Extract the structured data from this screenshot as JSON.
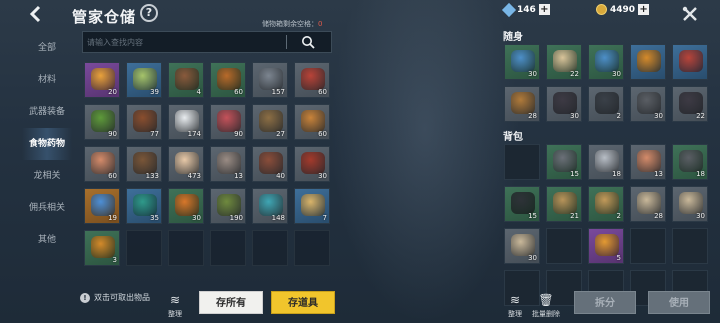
{
  "header": {
    "back_icon": "chevron-left-icon",
    "title": "管家仓储",
    "help_icon": "question-icon"
  },
  "capacity": {
    "label": "储物箱剩余空格：",
    "value": "0"
  },
  "search": {
    "placeholder": "请输入查找内容",
    "icon": "search-icon"
  },
  "sidebar": {
    "items": [
      {
        "label": "全部"
      },
      {
        "label": "材料"
      },
      {
        "label": "武器装备"
      },
      {
        "label": "食物药物",
        "active": true
      },
      {
        "label": "龙相关"
      },
      {
        "label": "佣兵相关"
      },
      {
        "label": "其他"
      }
    ]
  },
  "currency": {
    "gems": "146",
    "gold": "4490"
  },
  "warehouse": {
    "items": [
      {
        "q": "purple",
        "count": "20",
        "icon": "orange-drink-icon",
        "color": "#e9a23b"
      },
      {
        "q": "blue",
        "count": "39",
        "icon": "soup-bowl-icon",
        "color": "#a6c46a"
      },
      {
        "q": "green",
        "count": "4",
        "icon": "meat-platter-icon",
        "color": "#8a5a3c"
      },
      {
        "q": "green",
        "count": "60",
        "icon": "barrel-icon",
        "color": "#b86a2a"
      },
      {
        "q": "grey",
        "count": "157",
        "icon": "herb-icon",
        "color": "#7c8590"
      },
      {
        "q": "grey",
        "count": "60",
        "icon": "berries-icon",
        "color": "#b84338"
      },
      {
        "q": "grey",
        "count": "90",
        "icon": "leaf-food-icon",
        "color": "#5e9a3a"
      },
      {
        "q": "grey",
        "count": "77",
        "icon": "roast-meat-icon",
        "color": "#8a4e2e"
      },
      {
        "q": "grey",
        "count": "174",
        "icon": "rice-ball-icon",
        "color": "#e8ecef"
      },
      {
        "q": "grey",
        "count": "90",
        "icon": "raw-meat-icon",
        "color": "#c4525a"
      },
      {
        "q": "grey",
        "count": "27",
        "icon": "branch-icon",
        "color": "#8c6e44"
      },
      {
        "q": "grey",
        "count": "60",
        "icon": "stew-bowl-icon",
        "color": "#c8833a"
      },
      {
        "q": "grey",
        "count": "60",
        "icon": "shrimp-icon",
        "color": "#d48b6a"
      },
      {
        "q": "grey",
        "count": "133",
        "icon": "turtle-icon",
        "color": "#7a5638"
      },
      {
        "q": "grey",
        "count": "473",
        "icon": "tofu-icon",
        "color": "#e8c9a8"
      },
      {
        "q": "grey",
        "count": "13",
        "icon": "root-icon",
        "color": "#9a8c84"
      },
      {
        "q": "grey",
        "count": "40",
        "icon": "drumstick-icon",
        "color": "#8a4d3a"
      },
      {
        "q": "grey",
        "count": "30",
        "icon": "sausage-icon",
        "color": "#a33a2c"
      },
      {
        "q": "orange",
        "count": "19",
        "icon": "blue-potion-icon",
        "color": "#4d8fd6"
      },
      {
        "q": "blue",
        "count": "35",
        "icon": "teal-pouch-icon",
        "color": "#2f9a8a"
      },
      {
        "q": "green",
        "count": "30",
        "icon": "hotpot-icon",
        "color": "#d8772a"
      },
      {
        "q": "grey",
        "count": "190",
        "icon": "vine-icon",
        "color": "#6f8a3e"
      },
      {
        "q": "grey",
        "count": "148",
        "icon": "coral-icon",
        "color": "#3fa6b4"
      },
      {
        "q": "blue",
        "count": "7",
        "icon": "porridge-icon",
        "color": "#d9b46a"
      },
      {
        "q": "green",
        "count": "3",
        "icon": "pumpkin-pot-icon",
        "color": "#d38a2a"
      },
      {
        "q": "empty",
        "count": ""
      },
      {
        "q": "empty",
        "count": ""
      },
      {
        "q": "empty",
        "count": ""
      },
      {
        "q": "empty",
        "count": ""
      },
      {
        "q": "empty",
        "count": ""
      }
    ]
  },
  "carry": {
    "title": "随身",
    "items": [
      {
        "q": "green",
        "count": "30",
        "icon": "blue-cloth-icon",
        "color": "#4d8fc8"
      },
      {
        "q": "green",
        "count": "22",
        "icon": "bread-plate-icon",
        "color": "#d9c49a"
      },
      {
        "q": "green",
        "count": "30",
        "icon": "blue-cloth-icon",
        "color": "#4d8fc8"
      },
      {
        "q": "blue",
        "count": "",
        "icon": "gourd-icon",
        "color": "#d58a2a"
      },
      {
        "q": "blue",
        "count": "",
        "icon": "red-cloth-icon",
        "color": "#b8443a"
      },
      {
        "q": "grey",
        "count": "28",
        "icon": "wood-log-icon",
        "color": "#b07a3a"
      },
      {
        "q": "grey",
        "count": "30",
        "icon": "dark-ore-icon",
        "color": "#3d3a44"
      },
      {
        "q": "grey",
        "count": "2",
        "icon": "dark-sticks-icon",
        "color": "#3a4048"
      },
      {
        "q": "grey",
        "count": "30",
        "icon": "iron-ingot-icon",
        "color": "#5a5e64"
      },
      {
        "q": "grey",
        "count": "22",
        "icon": "dark-ore-icon",
        "color": "#3d3a44"
      }
    ]
  },
  "bag": {
    "title": "背包",
    "items": [
      {
        "q": "dark",
        "count": "",
        "icon": "",
        "color": ""
      },
      {
        "q": "green",
        "count": "15",
        "icon": "iron-ingot-icon",
        "color": "#6b7078"
      },
      {
        "q": "grey",
        "count": "18",
        "icon": "silver-ore-icon",
        "color": "#b8bec6"
      },
      {
        "q": "grey",
        "count": "13",
        "icon": "shrimp-icon",
        "color": "#d48b6a"
      },
      {
        "q": "green",
        "count": "18",
        "icon": "iron-ingot-icon",
        "color": "#5a5e64"
      },
      {
        "q": "green",
        "count": "15",
        "icon": "dark-ingot-icon",
        "color": "#2e3238"
      },
      {
        "q": "green",
        "count": "21",
        "icon": "plank-icon",
        "color": "#b8945a"
      },
      {
        "q": "green",
        "count": "2",
        "icon": "plank-icon",
        "color": "#c29a5a"
      },
      {
        "q": "grey",
        "count": "28",
        "icon": "stone-icon",
        "color": "#c9b89a"
      },
      {
        "q": "grey",
        "count": "30",
        "icon": "stone-icon",
        "color": "#c9b89a"
      },
      {
        "q": "grey",
        "count": "30",
        "icon": "stone-icon",
        "color": "#c9b89a"
      },
      {
        "q": "dark",
        "count": "",
        "icon": "",
        "color": ""
      },
      {
        "q": "purple",
        "count": "5",
        "icon": "orange-jar-icon",
        "color": "#e39a32"
      },
      {
        "q": "dark",
        "count": "",
        "icon": "",
        "color": ""
      },
      {
        "q": "dark",
        "count": "",
        "icon": "",
        "color": ""
      },
      {
        "q": "dark",
        "count": "",
        "icon": "",
        "color": ""
      },
      {
        "q": "dark",
        "count": "",
        "icon": "",
        "color": ""
      },
      {
        "q": "dark",
        "count": "",
        "icon": "",
        "color": ""
      },
      {
        "q": "dark",
        "count": "",
        "icon": "",
        "color": ""
      },
      {
        "q": "dark",
        "count": "",
        "icon": "",
        "color": ""
      }
    ]
  },
  "footer": {
    "tip": "双击可取出物品",
    "sort_label": "整理",
    "store_all": "存所有",
    "store_items": "存道具",
    "bag_sort_label": "整理",
    "batch_delete": "批量删除",
    "split": "拆分",
    "use": "使用"
  }
}
